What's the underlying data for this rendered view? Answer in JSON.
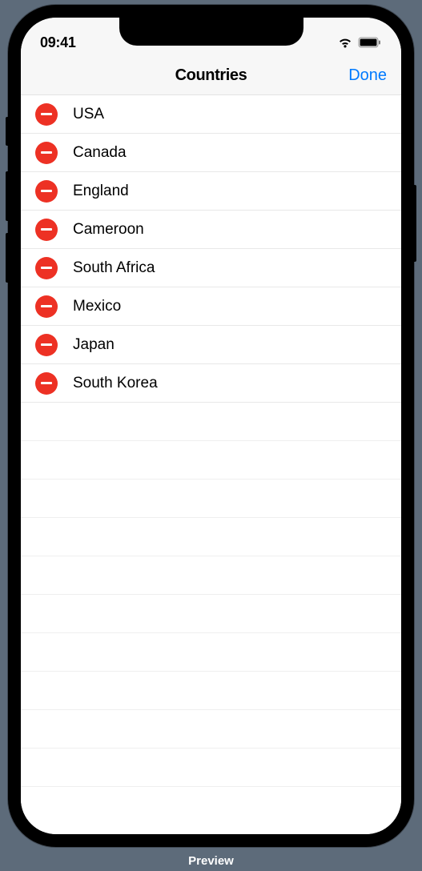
{
  "status_bar": {
    "time": "09:41"
  },
  "nav": {
    "title": "Countries",
    "done": "Done"
  },
  "countries": [
    {
      "name": "USA"
    },
    {
      "name": "Canada"
    },
    {
      "name": "England"
    },
    {
      "name": "Cameroon"
    },
    {
      "name": "South Africa"
    },
    {
      "name": "Mexico"
    },
    {
      "name": "Japan"
    },
    {
      "name": "South Korea"
    }
  ],
  "empty_rows": 10,
  "footer": {
    "preview": "Preview"
  }
}
